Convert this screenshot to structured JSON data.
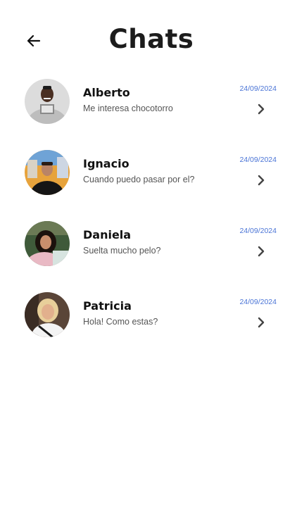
{
  "header": {
    "title": "Chats",
    "back_icon": "arrow-left-icon"
  },
  "colors": {
    "date": "#4a74d6",
    "title": "#1c1c1c",
    "message": "#555555"
  },
  "chats": [
    {
      "name": "Alberto",
      "message": "Me interesa chocotorro",
      "date": "24/09/2024"
    },
    {
      "name": "Ignacio",
      "message": "Cuando puedo pasar por el?",
      "date": "24/09/2024"
    },
    {
      "name": "Daniela",
      "message": "Suelta mucho pelo?",
      "date": "24/09/2024"
    },
    {
      "name": "Patricia",
      "message": "Hola! Como estas?",
      "date": "24/09/2024"
    }
  ]
}
